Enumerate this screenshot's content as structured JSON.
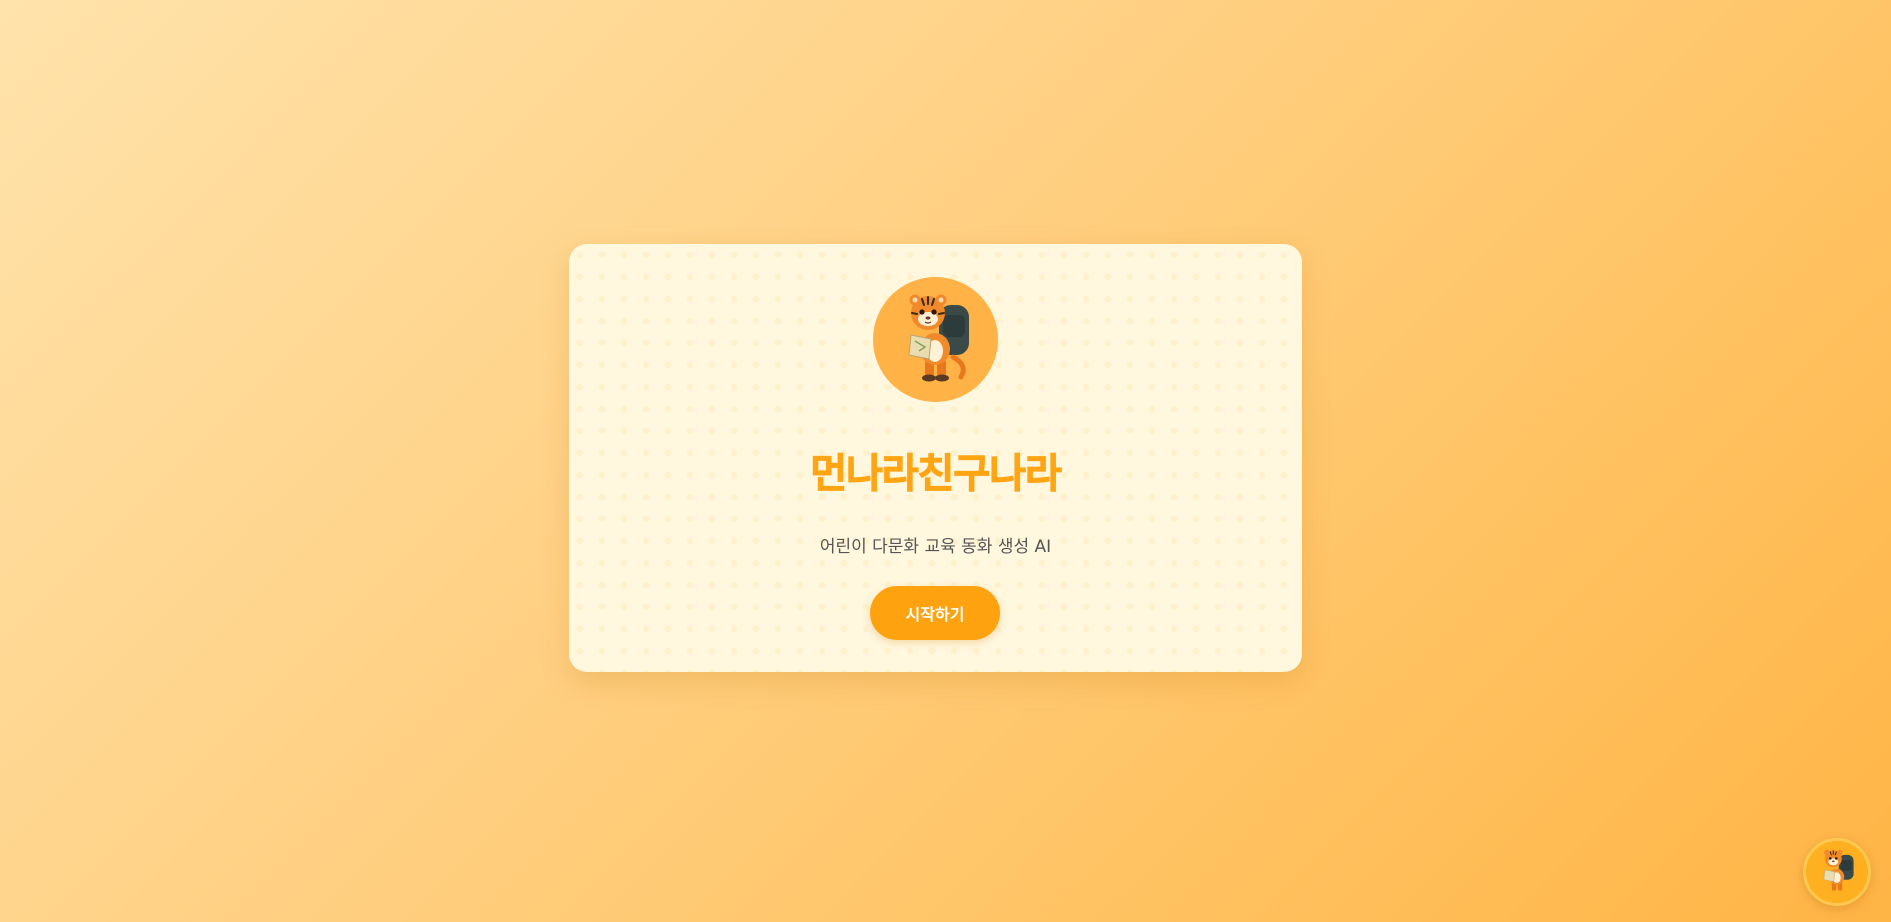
{
  "app": {
    "title": "먼나라친구나라",
    "subtitle": "어린이 다문화 교육 동화 생성 AI",
    "start_label": "시작하기"
  },
  "mascot": {
    "icon": "tiger-mascot-icon",
    "description_visible": false
  },
  "floating": {
    "icon": "tiger-mascot-icon"
  },
  "colors": {
    "accent": "#ffa412",
    "button": "#ffa20f",
    "card_bg": "#fff7de",
    "avatar_bg": "#ffb347",
    "text_secondary": "#555555"
  }
}
